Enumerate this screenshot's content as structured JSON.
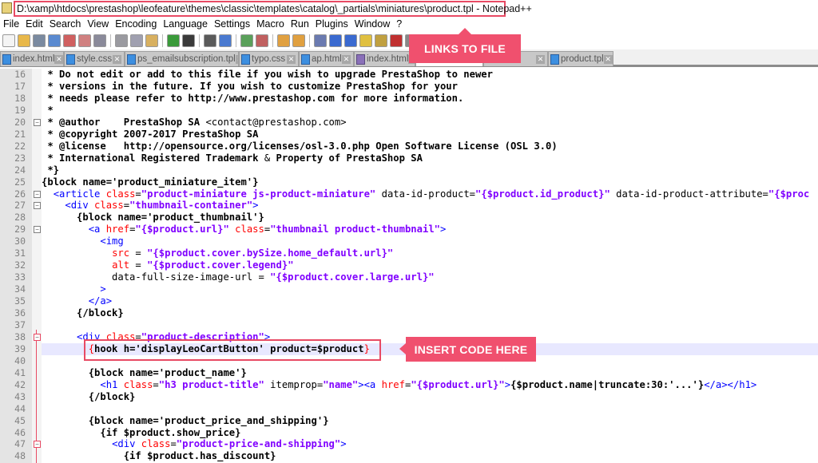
{
  "window": {
    "title": "D:\\xamp\\htdocs\\prestashop\\leofeature\\themes\\classic\\templates\\catalog\\_partials\\miniatures\\product.tpl - Notepad++"
  },
  "menu": [
    "File",
    "Edit",
    "Search",
    "View",
    "Encoding",
    "Language",
    "Settings",
    "Macro",
    "Run",
    "Plugins",
    "Window",
    "?"
  ],
  "toolbar": {
    "icons": [
      "new-file",
      "open-file",
      "save",
      "save-all",
      "close",
      "close-all",
      "print",
      "cut",
      "copy",
      "paste",
      "undo",
      "redo",
      "find",
      "replace",
      "zoom-in",
      "zoom-out",
      "sync-vertical",
      "sync-horizontal",
      "word-wrap",
      "show-all-characters",
      "indent-guide",
      "user-defined-language",
      "doc-map",
      "function-list",
      "macro-record"
    ]
  },
  "tabs": [
    {
      "label": "index.html",
      "icon": "blue"
    },
    {
      "label": "style.css",
      "icon": "blue"
    },
    {
      "label": "ps_emailsubscription.tpl",
      "icon": "blue"
    },
    {
      "label": "typo.css",
      "icon": "blue"
    },
    {
      "label": "ap.html",
      "icon": "blue"
    },
    {
      "label": "index.html",
      "icon": "purple"
    },
    {
      "label": "",
      "icon": "none",
      "active": true
    },
    {
      "label": "tml",
      "icon": "none"
    },
    {
      "label": "product.tpl",
      "icon": "blue"
    }
  ],
  "callouts": {
    "links": "LINKS TO FILE",
    "insert": "INSERT CODE HERE"
  },
  "colors": {
    "accent": "#f0506e",
    "tag": "#0000ff",
    "attribute": "#ff0000",
    "value": "#8000ff",
    "highlight_line": "#e8e8ff"
  },
  "editor": {
    "lines": [
      {
        "n": "16",
        "t": [
          [
            "c",
            " * Do not edit or add to this file if you wish to upgrade PrestaShop to newer"
          ]
        ]
      },
      {
        "n": "17",
        "t": [
          [
            "c",
            " * versions in the future. If you wish to customize PrestaShop for your"
          ]
        ]
      },
      {
        "n": "18",
        "t": [
          [
            "c",
            " * needs please refer to http://www.prestashop.com for more information."
          ]
        ]
      },
      {
        "n": "19",
        "t": [
          [
            "c",
            " *"
          ]
        ]
      },
      {
        "n": "20",
        "fold": true,
        "t": [
          [
            "c",
            " * @author    PrestaShop SA "
          ],
          [
            "p",
            "<contact@prestashop.com>"
          ]
        ]
      },
      {
        "n": "21",
        "t": [
          [
            "c",
            " * @copyright 2007-2017 PrestaShop SA"
          ]
        ]
      },
      {
        "n": "22",
        "t": [
          [
            "c",
            " * @license   http://opensource.org/licenses/osl-3.0.php Open Software License (OSL 3.0)"
          ]
        ]
      },
      {
        "n": "23",
        "t": [
          [
            "c",
            " * International Registered Trademark "
          ],
          [
            "p",
            "&"
          ],
          [
            "c",
            " Property of PrestaShop SA"
          ]
        ]
      },
      {
        "n": "24",
        "t": [
          [
            "c",
            " *}"
          ]
        ]
      },
      {
        "n": "25",
        "t": [
          [
            "s",
            "{block name='product_miniature_item'}"
          ]
        ]
      },
      {
        "n": "26",
        "fold": true,
        "t": [
          [
            "p",
            "  "
          ],
          [
            "t",
            "<article "
          ],
          [
            "a",
            "class"
          ],
          [
            "p",
            "="
          ],
          [
            "v",
            "\"product-miniature js-product-miniature\""
          ],
          [
            "p",
            " data-id-product="
          ],
          [
            "v",
            "\"{$product.id_product}\""
          ],
          [
            "p",
            " data-id-product-attribute="
          ],
          [
            "v",
            "\"{$proc"
          ]
        ]
      },
      {
        "n": "27",
        "fold": true,
        "t": [
          [
            "p",
            "    "
          ],
          [
            "t",
            "<div "
          ],
          [
            "a",
            "class"
          ],
          [
            "p",
            "="
          ],
          [
            "v",
            "\"thumbnail-container\""
          ],
          [
            "t",
            ">"
          ]
        ]
      },
      {
        "n": "28",
        "t": [
          [
            "s",
            "      {block name='product_thumbnail'}"
          ]
        ]
      },
      {
        "n": "29",
        "fold": true,
        "t": [
          [
            "p",
            "        "
          ],
          [
            "t",
            "<a "
          ],
          [
            "a",
            "href"
          ],
          [
            "p",
            "="
          ],
          [
            "v",
            "\"{$product.url}\""
          ],
          [
            "p",
            " "
          ],
          [
            "a",
            "class"
          ],
          [
            "p",
            "="
          ],
          [
            "v",
            "\"thumbnail product-thumbnail\""
          ],
          [
            "t",
            ">"
          ]
        ]
      },
      {
        "n": "30",
        "t": [
          [
            "p",
            "          "
          ],
          [
            "t",
            "<img"
          ]
        ]
      },
      {
        "n": "31",
        "t": [
          [
            "p",
            "            "
          ],
          [
            "a",
            "src"
          ],
          [
            "p",
            " = "
          ],
          [
            "v",
            "\"{$product.cover.bySize.home_default.url}\""
          ]
        ]
      },
      {
        "n": "32",
        "t": [
          [
            "p",
            "            "
          ],
          [
            "a",
            "alt"
          ],
          [
            "p",
            " = "
          ],
          [
            "v",
            "\"{$product.cover.legend}\""
          ]
        ]
      },
      {
        "n": "33",
        "t": [
          [
            "p",
            "            data-full-size-image-url = "
          ],
          [
            "v",
            "\"{$product.cover.large.url}\""
          ]
        ]
      },
      {
        "n": "34",
        "t": [
          [
            "p",
            "          "
          ],
          [
            "t",
            ">"
          ]
        ]
      },
      {
        "n": "35",
        "t": [
          [
            "p",
            "        "
          ],
          [
            "t",
            "</a>"
          ]
        ]
      },
      {
        "n": "36",
        "t": [
          [
            "s",
            "      {/block}"
          ]
        ]
      },
      {
        "n": "37",
        "t": []
      },
      {
        "n": "38",
        "fold": true,
        "red": true,
        "t": [
          [
            "p",
            "      "
          ],
          [
            "t",
            "<div "
          ],
          [
            "a",
            "class"
          ],
          [
            "p",
            "="
          ],
          [
            "v",
            "\"product-description\""
          ],
          [
            "t",
            ">"
          ]
        ]
      },
      {
        "n": "39",
        "hl": true,
        "t": [
          [
            "p",
            "        "
          ],
          [
            "r",
            "{"
          ],
          [
            "s",
            "hook h='displayLeoCartButton' product=$product"
          ],
          [
            "r",
            "}"
          ]
        ]
      },
      {
        "n": "40",
        "t": []
      },
      {
        "n": "41",
        "t": [
          [
            "s",
            "        {block name='product_name'}"
          ]
        ]
      },
      {
        "n": "42",
        "t": [
          [
            "p",
            "          "
          ],
          [
            "t",
            "<h1 "
          ],
          [
            "a",
            "class"
          ],
          [
            "p",
            "="
          ],
          [
            "v",
            "\"h3 product-title\""
          ],
          [
            "p",
            " itemprop="
          ],
          [
            "v",
            "\"name\""
          ],
          [
            "t",
            ">"
          ],
          [
            "t",
            "<a "
          ],
          [
            "a",
            "href"
          ],
          [
            "p",
            "="
          ],
          [
            "v",
            "\"{$product.url}\""
          ],
          [
            "t",
            ">"
          ],
          [
            "s",
            "{$product.name|truncate:30:'...'}"
          ],
          [
            "t",
            "</a></h1>"
          ]
        ]
      },
      {
        "n": "43",
        "t": [
          [
            "s",
            "        {/block}"
          ]
        ]
      },
      {
        "n": "44",
        "t": []
      },
      {
        "n": "45",
        "t": [
          [
            "s",
            "        {block name='product_price_and_shipping'}"
          ]
        ]
      },
      {
        "n": "46",
        "t": [
          [
            "s",
            "          {if $product.show_price}"
          ]
        ]
      },
      {
        "n": "47",
        "fold": true,
        "red": true,
        "t": [
          [
            "p",
            "            "
          ],
          [
            "t",
            "<div "
          ],
          [
            "a",
            "class"
          ],
          [
            "p",
            "="
          ],
          [
            "v",
            "\"product-price-and-shipping\""
          ],
          [
            "t",
            ">"
          ]
        ]
      },
      {
        "n": "48",
        "t": [
          [
            "s",
            "              {if $product.has_discount}"
          ]
        ]
      }
    ]
  }
}
